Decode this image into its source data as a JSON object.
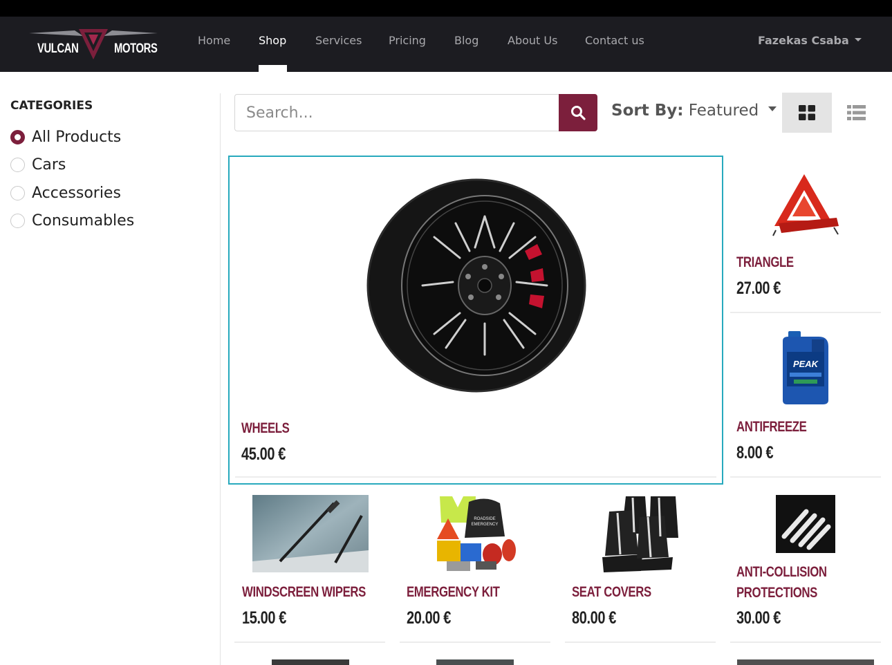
{
  "brand": {
    "left": "VULCAN",
    "right": "MOTORS"
  },
  "nav": {
    "items": [
      {
        "label": "Home"
      },
      {
        "label": "Shop",
        "active": true
      },
      {
        "label": "Services"
      },
      {
        "label": "Pricing"
      },
      {
        "label": "Blog"
      },
      {
        "label": "About Us"
      },
      {
        "label": "Contact us"
      }
    ],
    "user": "Fazekas Csaba"
  },
  "sidebar": {
    "title": "CATEGORIES",
    "categories": [
      {
        "label": "All Products",
        "selected": true
      },
      {
        "label": "Cars",
        "selected": false
      },
      {
        "label": "Accessories",
        "selected": false
      },
      {
        "label": "Consumables",
        "selected": false
      }
    ]
  },
  "toolbar": {
    "search_placeholder": "Search...",
    "sort_label": "Sort By:",
    "sort_value": "Featured"
  },
  "products": [
    {
      "name": "WHEELS",
      "price": "45.00 €"
    },
    {
      "name": "TRIANGLE",
      "price": "27.00 €"
    },
    {
      "name": "ANTIFREEZE",
      "price": "8.00 €"
    },
    {
      "name": "WINDSCREEN WIPERS",
      "price": "15.00 €"
    },
    {
      "name": "EMERGENCY KIT",
      "price": "20.00 €"
    },
    {
      "name": "SEAT COVERS",
      "price": "80.00 €"
    },
    {
      "name": "ANTI-COLLISION",
      "name2": "PROTECTIONS",
      "price": "30.00 €"
    }
  ],
  "colors": {
    "accent": "#7c1f3c",
    "navbar": "#1c1c21",
    "highlight": "#27a9bd"
  }
}
